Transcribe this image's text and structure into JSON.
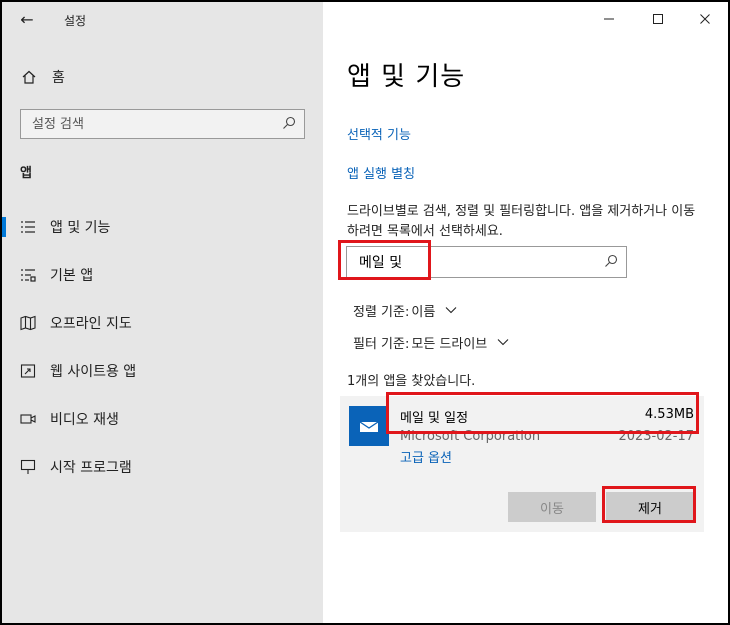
{
  "window": {
    "title": "설정",
    "back_icon": "back-arrow-icon",
    "controls": [
      "minimize-icon",
      "maximize-icon",
      "close-icon"
    ]
  },
  "sidebar": {
    "home_label": "홈",
    "search_placeholder": "설정 검색",
    "section_title": "앱",
    "items": [
      {
        "label": "앱 및 기능",
        "icon": "list-icon",
        "active": true
      },
      {
        "label": "기본 앱",
        "icon": "default-apps-icon",
        "active": false
      },
      {
        "label": "오프라인 지도",
        "icon": "map-icon",
        "active": false
      },
      {
        "label": "웹 사이트용 앱",
        "icon": "website-apps-icon",
        "active": false
      },
      {
        "label": "비디오 재생",
        "icon": "video-icon",
        "active": false
      },
      {
        "label": "시작 프로그램",
        "icon": "startup-icon",
        "active": false
      }
    ]
  },
  "main": {
    "title": "앱 및 기능",
    "links": [
      "선택적 기능",
      "앱 실행 별칭"
    ],
    "description": "드라이브별로 검색, 정렬 및 필터링합니다. 앱을 제거하거나 이동하려면 목록에서 선택하세요.",
    "search_value": "메일 및",
    "sort_label": "정렬 기준:",
    "sort_value": "이름",
    "filter_label": "필터 기준:",
    "filter_value": "모든 드라이브",
    "result_count": "1개의 앱을 찾았습니다.",
    "app": {
      "name": "메일 및 일정",
      "size": "4.53MB",
      "publisher": "Microsoft Corporation",
      "date": "2023-02-17",
      "advanced_options": "고급 옵션",
      "move_button": "이동",
      "remove_button": "제거"
    }
  },
  "colors": {
    "accent": "#0078d7",
    "link": "#0a63b8",
    "highlight": "#e0161b",
    "sidebar_bg": "#e6e6e6"
  }
}
